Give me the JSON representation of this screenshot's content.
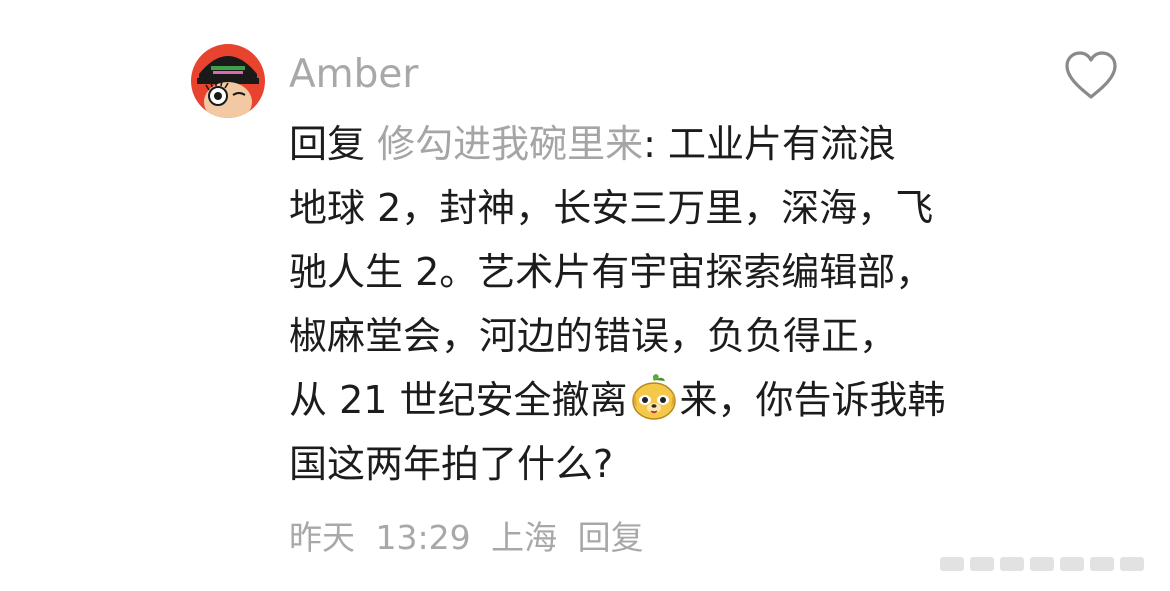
{
  "comment": {
    "username": "Amber",
    "reply_prefix": "回复",
    "reply_target": "修勾进我碗里来",
    "line1_rest": ": 工业片有流浪",
    "lines": [
      "地球 2，封神，长安三万里，深海，飞",
      "驰人生 2。艺术片有宇宙探索编辑部，",
      "椒麻堂会，河边的错误，负负得正，"
    ],
    "line5_before_emoji": "从 21 世纪安全撤离",
    "line5_after_emoji": "来，你告诉我韩",
    "line6": "国这两年拍了什么?",
    "emoji": "dog-emoji",
    "avatar": "avatar-image"
  },
  "meta": {
    "date": "昨天",
    "time": "13:29",
    "location": "上海",
    "reply_label": "回复"
  },
  "icons": {
    "like": "heart-outline-icon"
  },
  "colors": {
    "text": "#1c1c1c",
    "muted": "#a8a8a8",
    "avatar_bg": "#e8432e"
  }
}
